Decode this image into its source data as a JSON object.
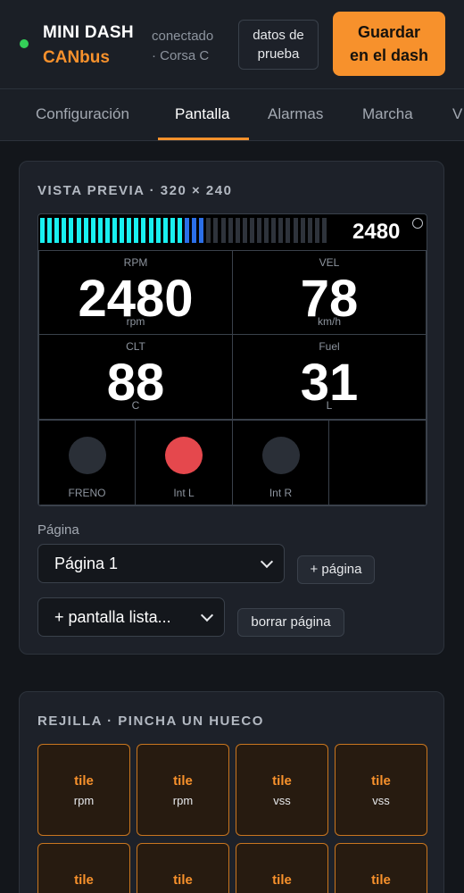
{
  "header": {
    "brand_name": "MINI DASH",
    "brand_sub": "CANbus",
    "status_line1": "conectado",
    "status_line2": "· Corsa C",
    "test_button_line1": "datos de",
    "test_button_line2": "prueba",
    "save_button_line1": "Guardar",
    "save_button_line2": "en el dash",
    "status_color": "#34d058",
    "accent_color": "#f7912c"
  },
  "tabs": [
    {
      "label": "Configuración",
      "active": false
    },
    {
      "label": "Pantalla",
      "active": true
    },
    {
      "label": "Alarmas",
      "active": false
    },
    {
      "label": "Marcha",
      "active": false
    },
    {
      "label": "V",
      "active": false
    }
  ],
  "preview": {
    "title": "VISTA PREVIA · 320 × 240",
    "rpm_bar_fill": 0.58,
    "rpm_value": "2480",
    "gauges": [
      {
        "label": "RPM",
        "value": "2480",
        "unit": "rpm"
      },
      {
        "label": "VEL",
        "value": "78",
        "unit": "km/h"
      },
      {
        "label": "CLT",
        "value": "88",
        "unit": "C"
      },
      {
        "label": "Fuel",
        "value": "31",
        "unit": "L"
      }
    ],
    "lamps": [
      {
        "label": "FRENO",
        "on": false
      },
      {
        "label": "Int L",
        "on": true
      },
      {
        "label": "Int R",
        "on": false
      },
      {
        "label": "",
        "on": false
      }
    ],
    "lamp_on_color": "#e5484d",
    "lamp_off_color": "#2a2f37",
    "page_label": "Página",
    "page_select": "Página 1",
    "add_page_button": "+ página",
    "ready_screen_select": "+ pantalla lista...",
    "delete_page_button": "borrar página"
  },
  "grid": {
    "title": "REJILLA · PINCHA UN HUECO",
    "tiles": [
      {
        "name": "tile",
        "signal": "rpm"
      },
      {
        "name": "tile",
        "signal": "rpm"
      },
      {
        "name": "tile",
        "signal": "vss"
      },
      {
        "name": "tile",
        "signal": "vss"
      },
      {
        "name": "tile",
        "signal": ""
      },
      {
        "name": "tile",
        "signal": ""
      },
      {
        "name": "tile",
        "signal": ""
      },
      {
        "name": "tile",
        "signal": ""
      }
    ]
  }
}
